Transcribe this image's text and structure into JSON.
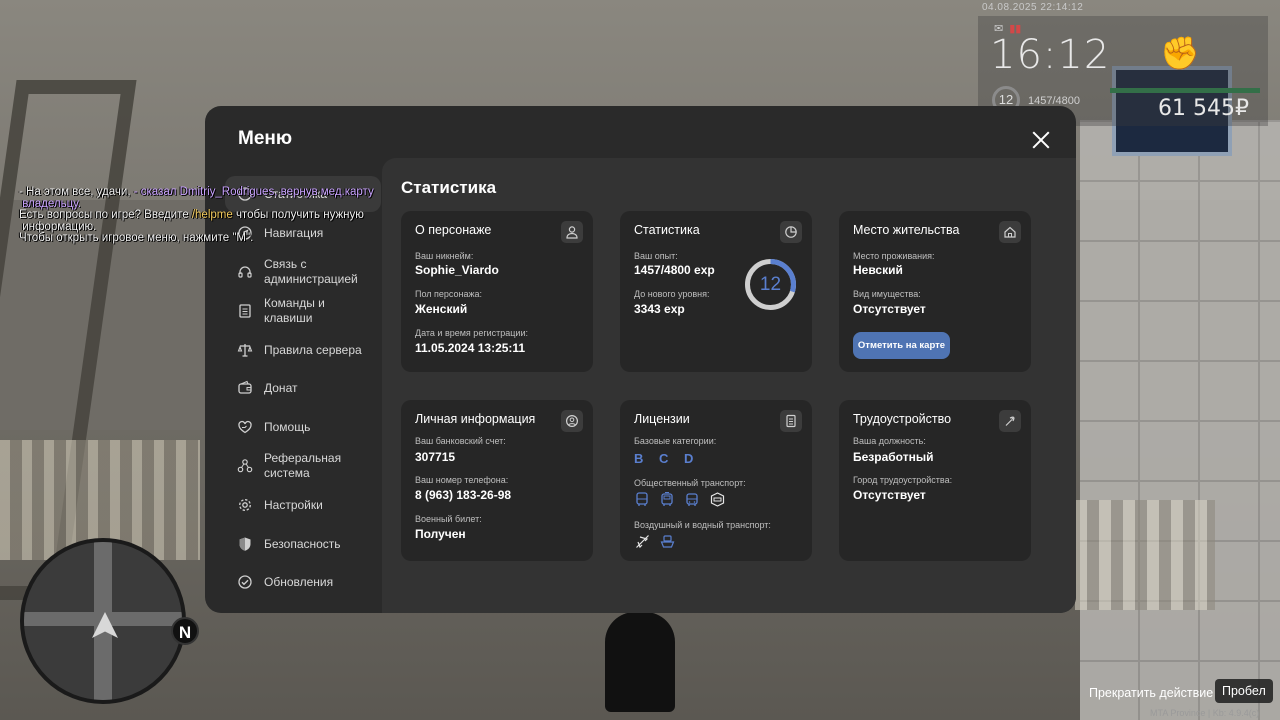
{
  "hud": {
    "datetime": "04.08.2025 22:14:12",
    "time": "16:12",
    "level": "12",
    "exp": "1457/4800",
    "money": "61 545₽"
  },
  "chat": [
    {
      "segments": [
        {
          "text": "- На этом все, удачи, ",
          "color": "white"
        },
        {
          "text": "- сказал Dmitriy_Rodrigues, вернув мед.карту",
          "color": "purple"
        }
      ]
    },
    {
      "segments": [
        {
          "text": " владельцу.",
          "color": "purple"
        }
      ]
    },
    {
      "segments": [
        {
          "text": "Есть вопросы по игре? Введите ",
          "color": "white"
        },
        {
          "text": "/helpme",
          "color": "yellow"
        },
        {
          "text": " чтобы получить нужную",
          "color": "white"
        }
      ]
    },
    {
      "segments": [
        {
          "text": " информацию.",
          "color": "white"
        }
      ]
    },
    {
      "segments": [
        {
          "text": "Чтобы открыть игровое меню, нажмите \"M\".",
          "color": "white"
        }
      ]
    }
  ],
  "menu": {
    "title": "Меню",
    "sidebar": [
      {
        "label": "Статистика",
        "icon": "chart-icon",
        "active": true
      },
      {
        "label": "Навигация",
        "icon": "compass-icon"
      },
      {
        "label": "Связь с\nадминистрацией",
        "icon": "headset-icon"
      },
      {
        "label": "Команды и\nклавиши",
        "icon": "document-icon"
      },
      {
        "label": "Правила сервера",
        "icon": "scales-icon"
      },
      {
        "label": "Донат",
        "icon": "wallet-icon"
      },
      {
        "label": "Помощь",
        "icon": "heart-hand-icon"
      },
      {
        "label": "Реферальная\nсистема",
        "icon": "referral-icon"
      },
      {
        "label": "Настройки",
        "icon": "gear-icon"
      },
      {
        "label": "Безопасность",
        "icon": "shield-icon"
      },
      {
        "label": "Обновления",
        "icon": "update-icon"
      }
    ],
    "content_title": "Статистика",
    "cards": {
      "character": {
        "title": "О персонаже",
        "nickname_label": "Ваш никнейм:",
        "nickname": "Sophie_Viardo",
        "gender_label": "Пол персонажа:",
        "gender": "Женский",
        "reg_label": "Дата и время регистрации:",
        "reg": "11.05.2024 13:25:11"
      },
      "stats": {
        "title": "Статистика",
        "exp_label": "Ваш опыт:",
        "exp": "1457/4800 exp",
        "next_label": "До нового уровня:",
        "next": "3343 exp",
        "level": "12",
        "level_progress": 0.3
      },
      "residence": {
        "title": "Место жительства",
        "place_label": "Место проживания:",
        "place": "Невский",
        "property_label": "Вид имущества:",
        "property": "Отсутствует",
        "map_button": "Отметить на карте"
      },
      "personal": {
        "title": "Личная информация",
        "bank_label": "Ваш банковский счет:",
        "bank": "307715",
        "phone_label": "Ваш номер телефона:",
        "phone": "8 (963) 183-26-98",
        "military_label": "Военный билет:",
        "military": "Получен"
      },
      "licenses": {
        "title": "Лицензии",
        "base_label": "Базовые категории:",
        "base": "B C D",
        "public_label": "Общественный транспорт:",
        "public_icons": [
          "bus-icon",
          "tram-icon",
          "trolleybus-icon",
          "taxi-icon"
        ],
        "air_label": "Воздушный и водный транспорт:",
        "air_icons": [
          "plane-icon",
          "boat-icon"
        ]
      },
      "employment": {
        "title": "Трудоустройство",
        "position_label": "Ваша должность:",
        "position": "Безработный",
        "city_label": "Город трудоустройства:",
        "city": "Отсутствует"
      }
    }
  },
  "prompt": {
    "label": "Прекратить действие",
    "key": "Пробел"
  },
  "watermark": "MTA Province | Kb: 4.9.4(c)",
  "colors": {
    "accent": "#5a7fcf",
    "button": "#4f74b3",
    "panel": "#2a2a2a",
    "card": "#262626"
  }
}
